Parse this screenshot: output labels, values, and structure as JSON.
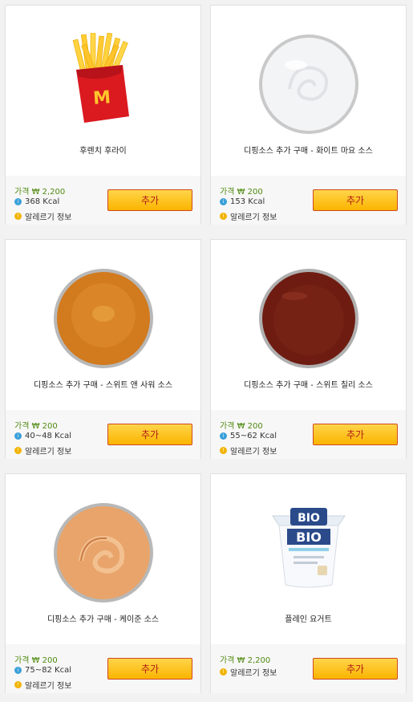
{
  "products": [
    {
      "name": "후렌치 후라이",
      "price": "가격 ₩ 2,200",
      "kcal": "368 Kcal",
      "allergy": "알레르기 정보",
      "button": "추가",
      "image": "french-fries"
    },
    {
      "name": "디핑소스 추가 구매 - 화이트 마요 소스",
      "price": "가격 ₩ 200",
      "kcal": "153 Kcal",
      "allergy": "알레르기 정보",
      "button": "추가",
      "image": "white-mayo-sauce",
      "color": "#f3f4f6"
    },
    {
      "name": "디핑소스 추가 구매 - 스위트 앤 사워 소스",
      "price": "가격 ₩ 200",
      "kcal": "40~48 Kcal",
      "allergy": "알레르기 정보",
      "button": "추가",
      "image": "sweet-and-sour-sauce",
      "color": "#d27a1e"
    },
    {
      "name": "디핑소스 추가 구매 - 스위트 칠리 소스",
      "price": "가격 ₩ 200",
      "kcal": "55~62 Kcal",
      "allergy": "알레르기 정보",
      "button": "추가",
      "image": "sweet-chili-sauce",
      "color": "#6e1c12"
    },
    {
      "name": "디핑소스 추가 구매 - 케이준 소스",
      "price": "가격 ₩ 200",
      "kcal": "75~82 Kcal",
      "allergy": "알레르기 정보",
      "button": "추가",
      "image": "cajun-sauce",
      "color": "#e8a46a"
    },
    {
      "name": "플레인 요거트",
      "price": "가격 ₩ 2,200",
      "allergy": "알레르기 정보",
      "button": "추가",
      "image": "plain-yogurt",
      "logo": "BIO"
    }
  ]
}
